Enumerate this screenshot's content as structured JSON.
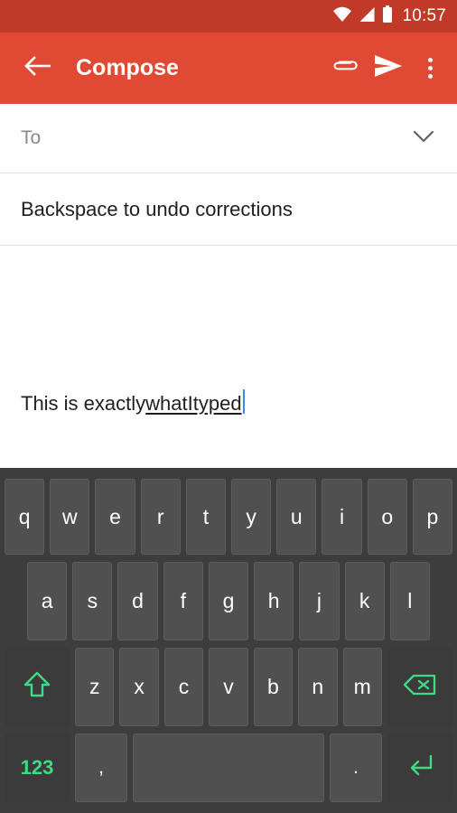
{
  "status_bar": {
    "time": "10:57",
    "icons": [
      "wifi-icon",
      "cell-signal-icon",
      "battery-icon"
    ],
    "background_color": "#c03a27"
  },
  "app_bar": {
    "title": "Compose",
    "back_icon": "back-arrow-icon",
    "actions": [
      {
        "name": "attach-button",
        "icon": "paperclip-icon"
      },
      {
        "name": "send-button",
        "icon": "send-icon"
      },
      {
        "name": "overflow-menu-button",
        "icon": "more-vert-icon"
      }
    ],
    "background_color": "#e04a34"
  },
  "compose": {
    "to_placeholder": "To",
    "to_expand_icon": "chevron-down-icon",
    "subject": "Backspace to undo corrections",
    "body_text": "This is exactly ",
    "body_composing_text": "whatItyped",
    "caret_color": "#4285f4"
  },
  "keyboard": {
    "background_color": "#3d3d3d",
    "key_color": "#505050",
    "accent_color": "#3ddc84",
    "rows": [
      [
        "q",
        "w",
        "e",
        "r",
        "t",
        "y",
        "u",
        "i",
        "o",
        "p"
      ],
      [
        "a",
        "s",
        "d",
        "f",
        "g",
        "h",
        "j",
        "k",
        "l"
      ],
      [
        "z",
        "x",
        "c",
        "v",
        "b",
        "n",
        "m"
      ]
    ],
    "shift_icon": "shift-arrow-icon",
    "backspace_icon": "backspace-icon",
    "numeric_label": "123",
    "comma_label": ",",
    "space_label": "",
    "period_label": ".",
    "enter_icon": "enter-return-icon"
  }
}
